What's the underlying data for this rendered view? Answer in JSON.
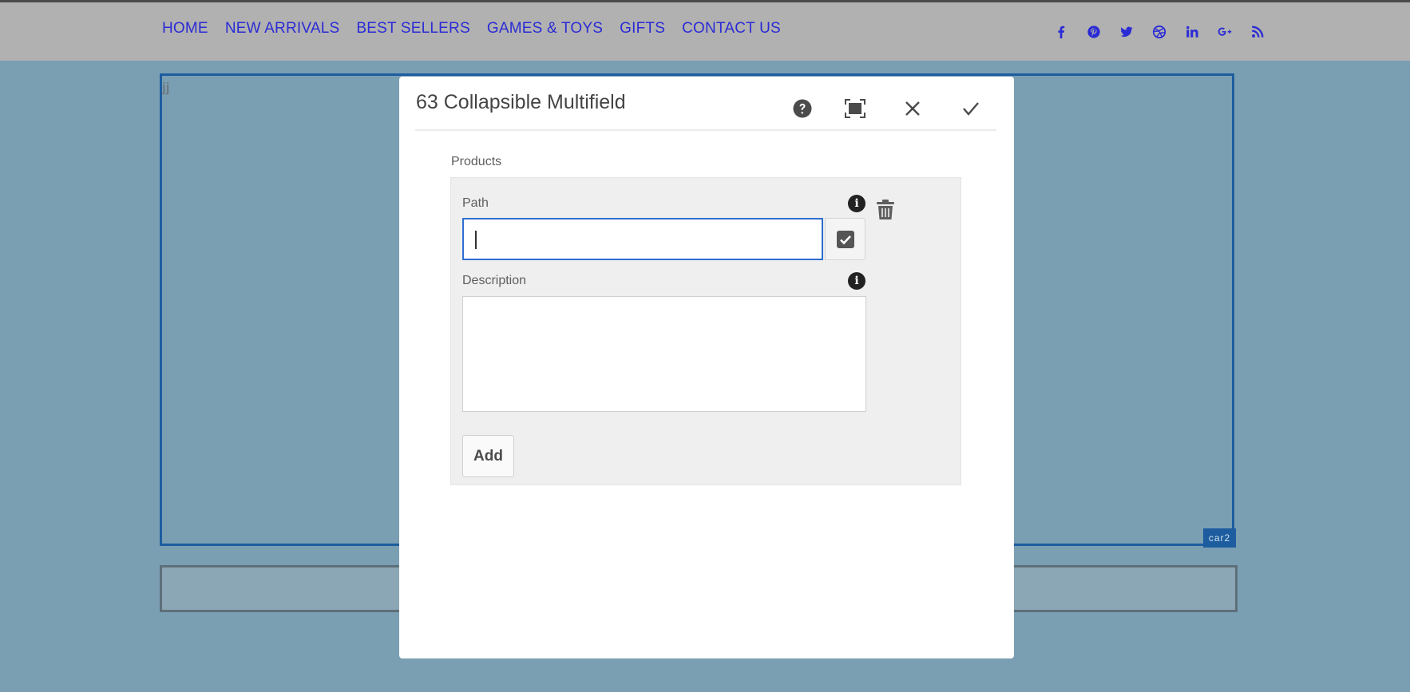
{
  "nav": {
    "items": [
      {
        "label": "HOME"
      },
      {
        "label": "NEW ARRIVALS"
      },
      {
        "label": "BEST SELLERS"
      },
      {
        "label": "GAMES & TOYS"
      },
      {
        "label": "GIFTS"
      },
      {
        "label": "CONTACT US"
      }
    ]
  },
  "social": {
    "icons": [
      "facebook-icon",
      "pinterest-icon",
      "twitter-icon",
      "dribbble-icon",
      "linkedin-icon",
      "google-plus-icon",
      "rss-icon"
    ],
    "color": "#2b2bd6"
  },
  "page": {
    "component_text": "jj",
    "component_badge": "car2"
  },
  "dialog": {
    "title": "63 Collapsible Multifield",
    "buttons": [
      "help-icon",
      "fullscreen-icon",
      "close-icon",
      "done-icon"
    ],
    "multifield_label": "Products",
    "path": {
      "label": "Path",
      "value": "",
      "placeholder": ""
    },
    "description": {
      "label": "Description",
      "value": ""
    },
    "add_label": "Add"
  },
  "colors": {
    "accent": "#2f6ed0",
    "frame": "#1d5d9f",
    "background": "#7a9fb3",
    "topbar": "#b1b1b1"
  }
}
